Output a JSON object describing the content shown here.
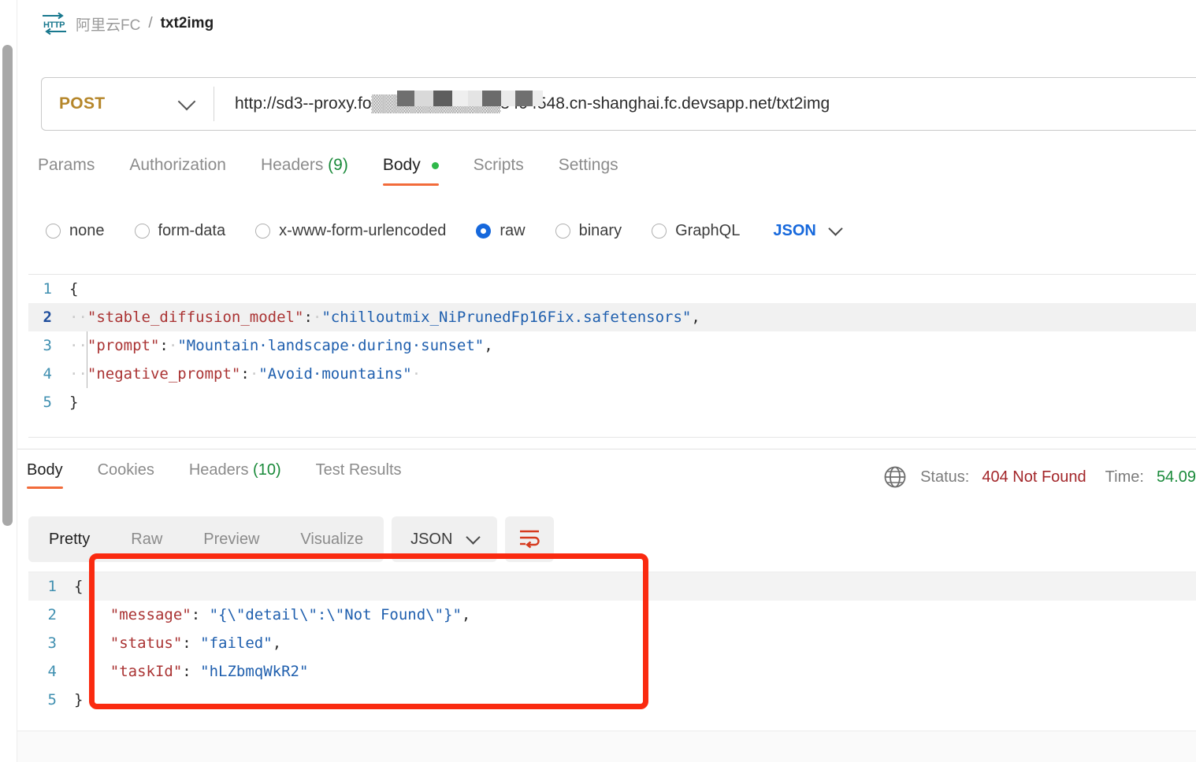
{
  "breadcrumb": {
    "protocol_icon": "http-icon",
    "collection": "阿里云FC",
    "separator": "/",
    "request_name": "txt2img"
  },
  "url_bar": {
    "method": "POST",
    "method_color": "#b5862a",
    "url_prefix": "http://sd3--proxy.f",
    "url_redacted_hint": "redacted",
    "url_suffix": "3494548.cn-shanghai.fc.devsapp.net/txt2img",
    "url_full_visible": "http://sd3--proxy.fo▒▒▒▒▒▒▒▒▒▒▒3494548.cn-shanghai.fc.devsapp.net/txt2img"
  },
  "request_tabs": [
    {
      "label": "Params",
      "count": "",
      "active": false,
      "dot": false
    },
    {
      "label": "Authorization",
      "count": "",
      "active": false,
      "dot": false
    },
    {
      "label": "Headers",
      "count": "(9)",
      "active": false,
      "dot": false
    },
    {
      "label": "Body",
      "count": "",
      "active": true,
      "dot": true
    },
    {
      "label": "Scripts",
      "count": "",
      "active": false,
      "dot": false
    },
    {
      "label": "Settings",
      "count": "",
      "active": false,
      "dot": false
    }
  ],
  "body_modes": [
    {
      "label": "none",
      "selected": false
    },
    {
      "label": "form-data",
      "selected": false
    },
    {
      "label": "x-www-form-urlencoded",
      "selected": false
    },
    {
      "label": "raw",
      "selected": true
    },
    {
      "label": "binary",
      "selected": false
    },
    {
      "label": "GraphQL",
      "selected": false
    }
  ],
  "body_format": {
    "label": "JSON",
    "color": "#1668dc"
  },
  "request_body": {
    "lines": [
      {
        "n": "1",
        "active": false,
        "tokens": [
          {
            "t": "{",
            "c": "p"
          }
        ]
      },
      {
        "n": "2",
        "active": true,
        "tokens": [
          {
            "t": "··",
            "c": "dot"
          },
          {
            "t": "\"stable_diffusion_model\"",
            "c": "k"
          },
          {
            "t": ":",
            "c": "p"
          },
          {
            "t": "·",
            "c": "dot"
          },
          {
            "t": "\"chilloutmix_NiPrunedFp16Fix.safetensors\"",
            "c": "s"
          },
          {
            "t": ",",
            "c": "p"
          }
        ]
      },
      {
        "n": "3",
        "active": false,
        "tokens": [
          {
            "t": "··",
            "c": "dot"
          },
          {
            "t": "\"prompt\"",
            "c": "k"
          },
          {
            "t": ":",
            "c": "p"
          },
          {
            "t": "·",
            "c": "dot"
          },
          {
            "t": "\"Mountain·landscape·during·sunset\"",
            "c": "s"
          },
          {
            "t": ",",
            "c": "p"
          }
        ]
      },
      {
        "n": "4",
        "active": false,
        "tokens": [
          {
            "t": "··",
            "c": "dot"
          },
          {
            "t": "\"negative_prompt\"",
            "c": "k"
          },
          {
            "t": ":",
            "c": "p"
          },
          {
            "t": "·",
            "c": "dot"
          },
          {
            "t": "\"Avoid·mountains\"",
            "c": "s"
          },
          {
            "t": "·",
            "c": "dot"
          }
        ]
      },
      {
        "n": "5",
        "active": false,
        "tokens": [
          {
            "t": "}",
            "c": "p"
          }
        ]
      }
    ],
    "raw_text": "{\n  \"stable_diffusion_model\": \"chilloutmix_NiPrunedFp16Fix.safetensors\",\n  \"prompt\": \"Mountain landscape during sunset\",\n  \"negative_prompt\": \"Avoid mountains\"\n}"
  },
  "response_tabs": [
    {
      "label": "Body",
      "count": "",
      "active": true
    },
    {
      "label": "Cookies",
      "count": "",
      "active": false
    },
    {
      "label": "Headers",
      "count": "(10)",
      "active": false
    },
    {
      "label": "Test Results",
      "count": "",
      "active": false
    }
  ],
  "response_meta": {
    "globe_icon": "globe-icon",
    "status_label": "Status:",
    "status_value": "404 Not Found",
    "status_color": "#a3262a",
    "time_label": "Time:",
    "time_value": "54.09",
    "time_color": "#1a8a3a"
  },
  "format_tabs": [
    {
      "label": "Pretty",
      "active": true
    },
    {
      "label": "Raw",
      "active": false
    },
    {
      "label": "Preview",
      "active": false
    },
    {
      "label": "Visualize",
      "active": false
    }
  ],
  "format_select": {
    "label": "JSON"
  },
  "wrap_button": {
    "icon": "wrap-lines-icon",
    "color": "#d63a1e"
  },
  "response_body": {
    "lines": [
      {
        "n": "1",
        "tokens": [
          {
            "t": "{",
            "c": "p"
          }
        ]
      },
      {
        "n": "2",
        "tokens": [
          {
            "t": "    ",
            "c": "p"
          },
          {
            "t": "\"message\"",
            "c": "k"
          },
          {
            "t": ": ",
            "c": "p"
          },
          {
            "t": "\"{\\\"detail\\\":\\\"Not Found\\\"}\"",
            "c": "s"
          },
          {
            "t": ",",
            "c": "p"
          }
        ]
      },
      {
        "n": "3",
        "tokens": [
          {
            "t": "    ",
            "c": "p"
          },
          {
            "t": "\"status\"",
            "c": "k"
          },
          {
            "t": ": ",
            "c": "p"
          },
          {
            "t": "\"failed\"",
            "c": "s"
          },
          {
            "t": ",",
            "c": "p"
          }
        ]
      },
      {
        "n": "4",
        "tokens": [
          {
            "t": "    ",
            "c": "p"
          },
          {
            "t": "\"taskId\"",
            "c": "k"
          },
          {
            "t": ": ",
            "c": "p"
          },
          {
            "t": "\"hLZbmqWkR2\"",
            "c": "s"
          }
        ]
      },
      {
        "n": "5",
        "tokens": [
          {
            "t": "}",
            "c": "p"
          }
        ]
      }
    ],
    "raw_text": "{\n    \"message\": \"{\\\"detail\\\":\\\"Not Found\\\"}\",\n    \"status\": \"failed\",\n    \"taskId\": \"hLZbmqWkR2\"\n}"
  },
  "annotation": {
    "shape": "rectangle",
    "color": "#fa2a10",
    "target": "response-body-json"
  }
}
